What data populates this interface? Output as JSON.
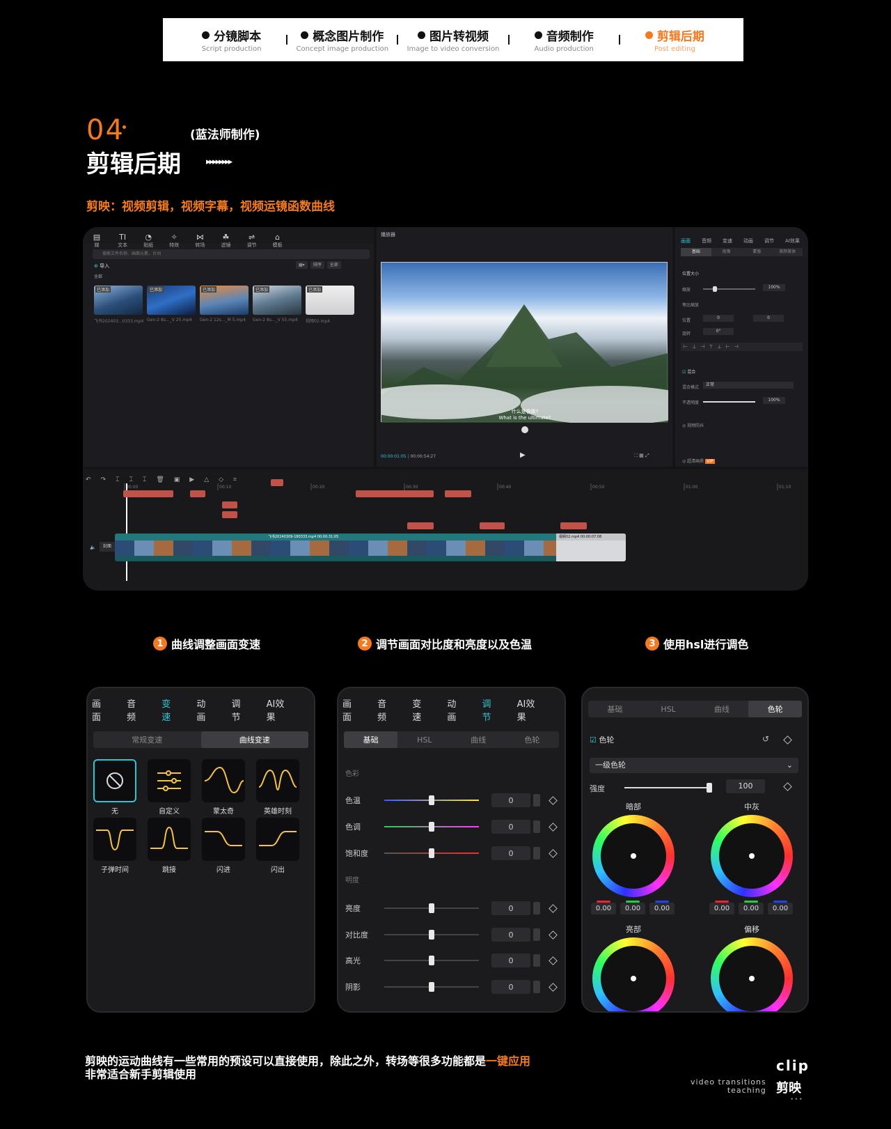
{
  "nav": {
    "steps": [
      {
        "zh": "分镜脚本",
        "en": "Script production"
      },
      {
        "zh": "概念图片制作",
        "en": "Concept image production"
      },
      {
        "zh": "图片转视频",
        "en": "Image to video conversion"
      },
      {
        "zh": "音频制作",
        "en": "Audio production"
      },
      {
        "zh": "剪辑后期",
        "en": "Post editing"
      }
    ],
    "active_color": "#f47a20"
  },
  "header": {
    "number": "04",
    "maker": "(蓝法师制作)",
    "title": "剪辑后期",
    "arrows": "▸▸▸▸▸▸▸▸",
    "subtitle": "剪映：视频剪辑，视频字幕，视频运镜函数曲线"
  },
  "editor": {
    "toolbar": [
      "文本",
      "贴纸",
      "特效",
      "转场",
      "滤镜",
      "调节",
      "模板"
    ],
    "search_placeholder": "搜索文件名称、画面元素、台词",
    "import_label": "导入",
    "all_label": "全部",
    "sort_labels": [
      "排序",
      "全部"
    ],
    "media": [
      {
        "tag": "已添加",
        "dur": "01:00",
        "caption": "飞书202403...0333.mp4"
      },
      {
        "tag": "已添加",
        "dur": "00:09",
        "caption": "Gen-2 8s..._V 25.mp4"
      },
      {
        "tag": "已添加",
        "dur": "00:09",
        "caption": "Gen-2 12s..._M 5.mp4"
      },
      {
        "tag": "已添加",
        "dur": "00:09",
        "caption": "Gen-2 8s..._V 55.mp4"
      },
      {
        "tag": "已添加",
        "dur": "",
        "caption": "视频02.mp4"
      }
    ],
    "player_title": "播放器",
    "subtitle_zh": "什么是极致?",
    "subtitle_en": "What is the ultimate?",
    "time_current": "00:00:01:05",
    "time_total": "00:00:54:27",
    "inspector_tabs": [
      "画面",
      "音频",
      "变速",
      "动画",
      "调节",
      "AI效果"
    ],
    "inspector_sub": [
      "基础",
      "抠像",
      "蒙版",
      "美颜美体"
    ],
    "inspector_rows": {
      "pos_size": "位置大小",
      "scale": "缩放",
      "scale_val": "100%",
      "uniform": "等比缩放",
      "position": "位置",
      "pos_x": "0",
      "pos_y": "0",
      "rotate": "旋转",
      "rotate_val": "0°",
      "blend": "混合",
      "blend_mode": "混合模式",
      "blend_mode_val": "正常",
      "opacity": "不透明度",
      "opacity_val": "100%",
      "stabilize": "视频防抖",
      "super_res": "超清画质",
      "vip": "VIP"
    },
    "timeline_ticks": [
      "00:00",
      "00:10",
      "00:20",
      "00:30",
      "00:40",
      "00:50",
      "01:00",
      "01:10"
    ],
    "track_cover": "封面",
    "main_clip_label": "飞书20240309-180333.mp4  00:00:31:05",
    "end_clip_label": "视频02.mp4  00:00:07:08"
  },
  "features": [
    {
      "n": "1",
      "text": "曲线调整画面变速"
    },
    {
      "n": "2",
      "text": "调节画面对比度和亮度以及色温"
    },
    {
      "n": "3",
      "text": "使用hsl进行调色"
    }
  ],
  "speed_panel": {
    "tabs": [
      "画面",
      "音频",
      "变速",
      "动画",
      "调节",
      "AI效果"
    ],
    "active_tab": "变速",
    "seg": [
      "常规变速",
      "曲线变速"
    ],
    "curves": [
      "无",
      "自定义",
      "蒙太奇",
      "英雄时刻",
      "子弹时间",
      "跳接",
      "闪进",
      "闪出"
    ]
  },
  "adjust_panel": {
    "tabs": [
      "画面",
      "音频",
      "变速",
      "动画",
      "调节",
      "AI效果"
    ],
    "active_tab": "调节",
    "seg": [
      "基础",
      "HSL",
      "曲线",
      "色轮"
    ],
    "section_color": "色彩",
    "section_light": "明度",
    "rows": [
      {
        "label": "色温",
        "value": "0"
      },
      {
        "label": "色调",
        "value": "0"
      },
      {
        "label": "饱和度",
        "value": "0"
      },
      {
        "label": "亮度",
        "value": "0"
      },
      {
        "label": "对比度",
        "value": "0"
      },
      {
        "label": "高光",
        "value": "0"
      },
      {
        "label": "阴影",
        "value": "0"
      }
    ]
  },
  "wheel_panel": {
    "seg": [
      "基础",
      "HSL",
      "曲线",
      "色轮"
    ],
    "toggle_label": "色轮",
    "dropdown": "一级色轮",
    "strength_label": "强度",
    "strength_value": "100",
    "wheels": [
      {
        "name": "暗部",
        "vals": [
          "0.00",
          "0.00",
          "0.00"
        ]
      },
      {
        "name": "中灰",
        "vals": [
          "0.00",
          "0.00",
          "0.00"
        ]
      },
      {
        "name": "亮部"
      },
      {
        "name": "偏移"
      }
    ]
  },
  "bottom": {
    "line1_pre": "剪映的运动曲线有一些常用的预设可以直接使用，除此之外，转场等很多功能都是",
    "line1_hl": "一键应用",
    "line2": "非常适合新手剪辑使用",
    "brand_en": "clip",
    "brand_sub1": "video transitions",
    "brand_sub2": "teaching",
    "brand_zh": "剪映",
    "dots": "•••"
  }
}
